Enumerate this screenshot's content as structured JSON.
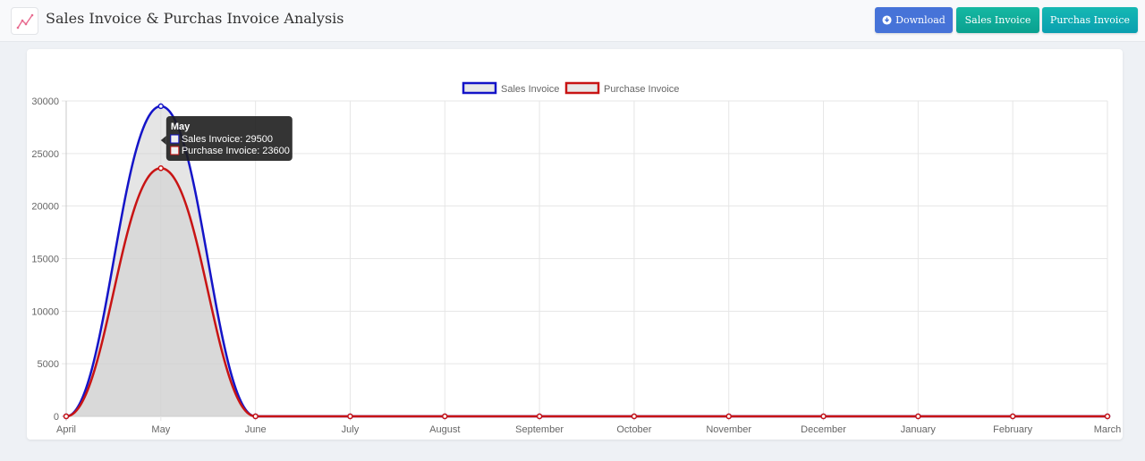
{
  "header": {
    "title": "Sales Invoice & Purchas Invoice Analysis",
    "icon": "line-chart-icon",
    "buttons": {
      "download": "Download",
      "sales": "Sales Invoice",
      "purchase": "Purchas Invoice"
    }
  },
  "colors": {
    "download_button": "#4673d8",
    "sales_button": "#12ad9a",
    "purchase_button": "#12acb3",
    "sales_line": "#1414c8",
    "purchase_line": "#c81414",
    "area_fill": "#d0d0d0",
    "tooltip_bg": "#1e1e1e"
  },
  "chart_data": {
    "type": "line",
    "categories": [
      "April",
      "May",
      "June",
      "July",
      "August",
      "September",
      "October",
      "November",
      "December",
      "January",
      "February",
      "March"
    ],
    "series": [
      {
        "name": "Sales Invoice",
        "values": [
          0,
          29500,
          0,
          0,
          0,
          0,
          0,
          0,
          0,
          0,
          0,
          0
        ]
      },
      {
        "name": "Purchase Invoice",
        "values": [
          0,
          23600,
          0,
          0,
          0,
          0,
          0,
          0,
          0,
          0,
          0,
          0
        ]
      }
    ],
    "ylim": [
      0,
      30000
    ],
    "yticks": [
      0,
      5000,
      10000,
      15000,
      20000,
      25000,
      30000
    ],
    "grid": true,
    "legend_position": "top",
    "tooltip": {
      "title": "May",
      "lines": [
        "Sales Invoice: 29500",
        "Purchase Invoice: 23600"
      ]
    }
  }
}
